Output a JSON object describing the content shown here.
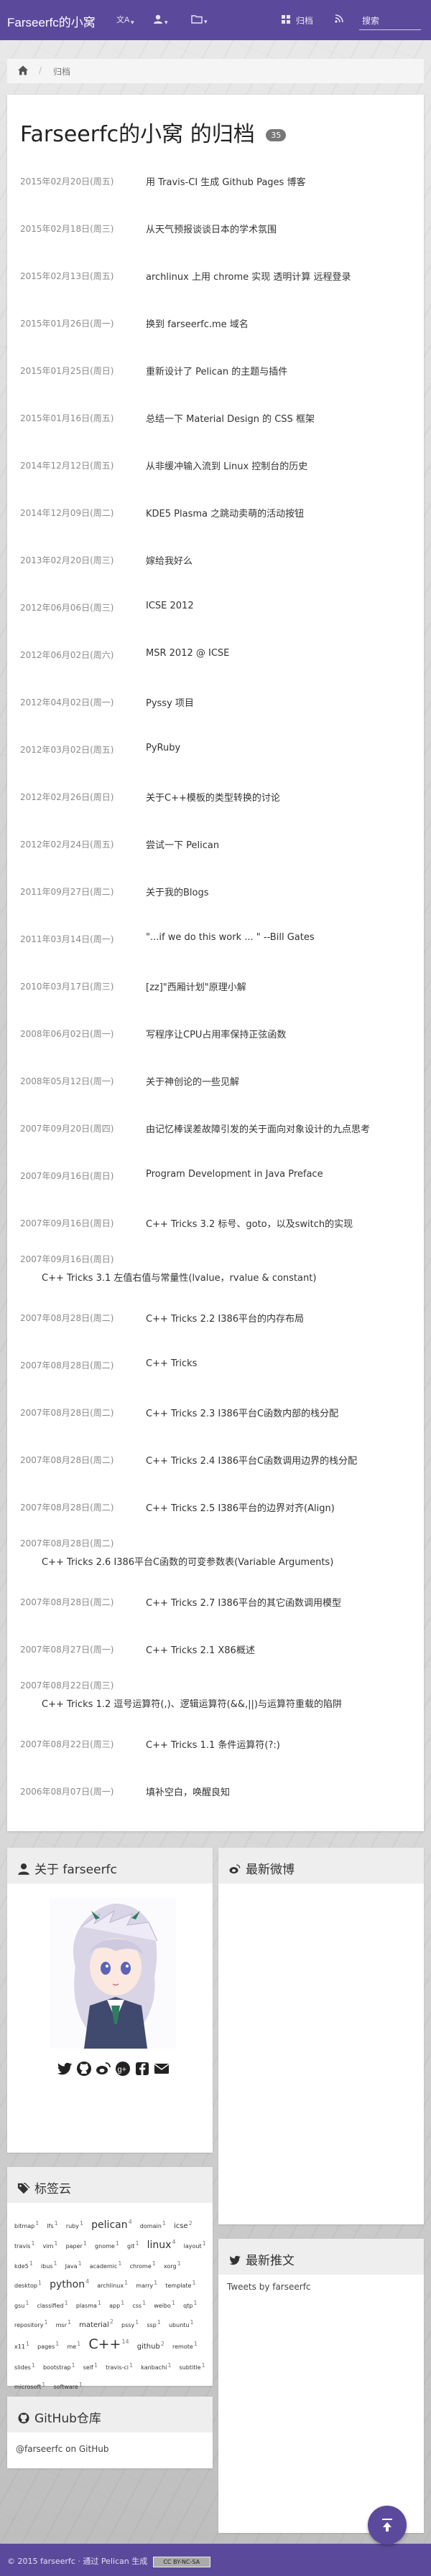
{
  "navbar": {
    "brand": "Farseerfc的小窝",
    "items": [
      {
        "icon": "translate-icon",
        "label": ""
      },
      {
        "icon": "user-icon",
        "label": ""
      },
      {
        "icon": "folder-icon",
        "label": ""
      },
      {
        "icon": "grid-icon",
        "label": "归档"
      },
      {
        "icon": "rss-icon",
        "label": ""
      }
    ],
    "search_placeholder": "搜索"
  },
  "breadcrumb": {
    "home_icon": "home-icon",
    "current": "归档"
  },
  "archive": {
    "title": "Farseerfc的小窝 的归档",
    "count": "35",
    "entries": [
      {
        "date": "2015年02月20日(周五)",
        "title": "用 Travis-CI 生成 Github Pages 博客"
      },
      {
        "date": "2015年02月18日(周三)",
        "title": "从天气预报谈谈日本的学术氛围"
      },
      {
        "date": "2015年02月13日(周五)",
        "title": "archlinux 上用 chrome 实现 透明计算 远程登录"
      },
      {
        "date": "2015年01月26日(周一)",
        "title": "换到 farseerfc.me 域名"
      },
      {
        "date": "2015年01月25日(周日)",
        "title": "重新设计了 Pelican 的主题与插件"
      },
      {
        "date": "2015年01月16日(周五)",
        "title": "总结一下 Material Design 的 CSS 框架"
      },
      {
        "date": "2014年12月12日(周五)",
        "title": "从非缓冲输入流到 Linux 控制台的历史"
      },
      {
        "date": "2014年12月09日(周二)",
        "title": "KDE5 Plasma 之跳动卖萌的活动按钮"
      },
      {
        "date": "2013年02月20日(周三)",
        "title": "嫁给我好么"
      },
      {
        "date": "2012年06月06日(周三)",
        "title": "ICSE 2012"
      },
      {
        "date": "2012年06月02日(周六)",
        "title": "MSR 2012 @ ICSE"
      },
      {
        "date": "2012年04月02日(周一)",
        "title": "Pyssy 项目"
      },
      {
        "date": "2012年03月02日(周五)",
        "title": "PyRuby"
      },
      {
        "date": "2012年02月26日(周日)",
        "title": "关于C++模板的类型转换的讨论"
      },
      {
        "date": "2012年02月24日(周五)",
        "title": "尝试一下 Pelican"
      },
      {
        "date": "2011年09月27日(周二)",
        "title": "关于我的Blogs"
      },
      {
        "date": "2011年03月14日(周一)",
        "title": "\"...if we do this work ... \" --Bill Gates"
      },
      {
        "date": "2010年03月17日(周三)",
        "title": "[zz]\"西厢计划\"原理小解"
      },
      {
        "date": "2008年06月02日(周一)",
        "title": "写程序让CPU占用率保持正弦函数"
      },
      {
        "date": "2008年05月12日(周一)",
        "title": "关于神创论的一些见解"
      },
      {
        "date": "2007年09月20日(周四)",
        "title": "由记忆棒误差故障引发的关于面向对象设计的九点思考"
      },
      {
        "date": "2007年09月16日(周日)",
        "title": "Program Development in Java Preface"
      },
      {
        "date": "2007年09月16日(周日)",
        "title": "C++ Tricks 3.2 标号、goto，以及switch的实现"
      },
      {
        "date": "2007年09月16日(周日)",
        "title": "C++ Tricks 3.1 左值右值与常量性(lvalue，rvalue & constant)",
        "stacked": true
      },
      {
        "date": "2007年08月28日(周二)",
        "title": "C++ Tricks 2.2 I386平台的内存布局"
      },
      {
        "date": "2007年08月28日(周二)",
        "title": "C++ Tricks"
      },
      {
        "date": "2007年08月28日(周二)",
        "title": "C++ Tricks 2.3 I386平台C函数内部的栈分配"
      },
      {
        "date": "2007年08月28日(周二)",
        "title": "C++ Tricks 2.4 I386平台C函数调用边界的栈分配"
      },
      {
        "date": "2007年08月28日(周二)",
        "title": "C++ Tricks 2.5 I386平台的边界对齐(Align)"
      },
      {
        "date": "2007年08月28日(周二)",
        "title": "C++ Tricks 2.6 I386平台C函数的可变参数表(Variable Arguments)",
        "stacked": true
      },
      {
        "date": "2007年08月28日(周二)",
        "title": "C++ Tricks 2.7 I386平台的其它函数调用模型"
      },
      {
        "date": "2007年08月27日(周一)",
        "title": "C++ Tricks 2.1 X86概述"
      },
      {
        "date": "2007年08月22日(周三)",
        "title": "C++ Tricks 1.2 逗号运算符(,)、逻辑运算符(&&,||)与运算符重载的陷阱",
        "stacked": true
      },
      {
        "date": "2007年08月22日(周三)",
        "title": "C++ Tricks 1.1 条件运算符(?:)"
      },
      {
        "date": "2006年08月07日(周一)",
        "title": "填补空白，唤醒良知"
      }
    ]
  },
  "about": {
    "title": "关于 farseerfc",
    "social": [
      "twitter-icon",
      "github-icon",
      "weibo-icon",
      "google-plus-icon",
      "facebook-icon",
      "email-icon"
    ]
  },
  "weibo": {
    "title": "最新微博"
  },
  "tags": {
    "title": "标签云",
    "items": [
      {
        "label": "bitmap",
        "count": "1"
      },
      {
        "label": "lfs",
        "count": "1"
      },
      {
        "label": "ruby",
        "count": "1"
      },
      {
        "label": "pelican",
        "count": "4"
      },
      {
        "label": "domain",
        "count": "1"
      },
      {
        "label": "icse",
        "count": "2"
      },
      {
        "label": "travis",
        "count": "1"
      },
      {
        "label": "vim",
        "count": "1"
      },
      {
        "label": "paper",
        "count": "1"
      },
      {
        "label": "gnome",
        "count": "1"
      },
      {
        "label": "git",
        "count": "1"
      },
      {
        "label": "linux",
        "count": "4"
      },
      {
        "label": "layout",
        "count": "1"
      },
      {
        "label": "kde5",
        "count": "1"
      },
      {
        "label": "ibus",
        "count": "1"
      },
      {
        "label": "Java",
        "count": "1"
      },
      {
        "label": "academic",
        "count": "1"
      },
      {
        "label": "chrome",
        "count": "1"
      },
      {
        "label": "xorg",
        "count": "1"
      },
      {
        "label": "desktop",
        "count": "1"
      },
      {
        "label": "python",
        "count": "4"
      },
      {
        "label": "archlinux",
        "count": "1"
      },
      {
        "label": "marry",
        "count": "1"
      },
      {
        "label": "template",
        "count": "1"
      },
      {
        "label": "gsu",
        "count": "1"
      },
      {
        "label": "classified",
        "count": "1"
      },
      {
        "label": "plasma",
        "count": "1"
      },
      {
        "label": "app",
        "count": "1"
      },
      {
        "label": "css",
        "count": "1"
      },
      {
        "label": "weibo",
        "count": "1"
      },
      {
        "label": "qtp",
        "count": "1"
      },
      {
        "label": "repository",
        "count": "1"
      },
      {
        "label": "msr",
        "count": "1"
      },
      {
        "label": "material",
        "count": "2"
      },
      {
        "label": "pssy",
        "count": "1"
      },
      {
        "label": "ssp",
        "count": "1"
      },
      {
        "label": "ubuntu",
        "count": "1"
      },
      {
        "label": "x11",
        "count": "1"
      },
      {
        "label": "pages",
        "count": "1"
      },
      {
        "label": "me",
        "count": "1"
      },
      {
        "label": "C++",
        "count": "14"
      },
      {
        "label": "github",
        "count": "2"
      },
      {
        "label": "remote",
        "count": "1"
      },
      {
        "label": "slides",
        "count": "1"
      },
      {
        "label": "bootstrap",
        "count": "1"
      },
      {
        "label": "self",
        "count": "1"
      },
      {
        "label": "travis-ci",
        "count": "1"
      },
      {
        "label": "kanbachi",
        "count": "1"
      },
      {
        "label": "subtitle",
        "count": "1"
      },
      {
        "label": "microsoft",
        "count": "1"
      },
      {
        "label": "software",
        "count": "1"
      }
    ]
  },
  "tweets": {
    "title": "最新推文",
    "link": "Tweets by farseerfc"
  },
  "github": {
    "title": "GitHub仓库",
    "link": "@farseerfc on GitHub"
  },
  "footer": {
    "text": "© 2015 farseerfc · 通过 Pelican 生成",
    "license": "CC BY-NC-SA"
  },
  "colors": {
    "primary": "#5b4a9b",
    "date": "#8a8a8a",
    "badge": "#777777"
  }
}
